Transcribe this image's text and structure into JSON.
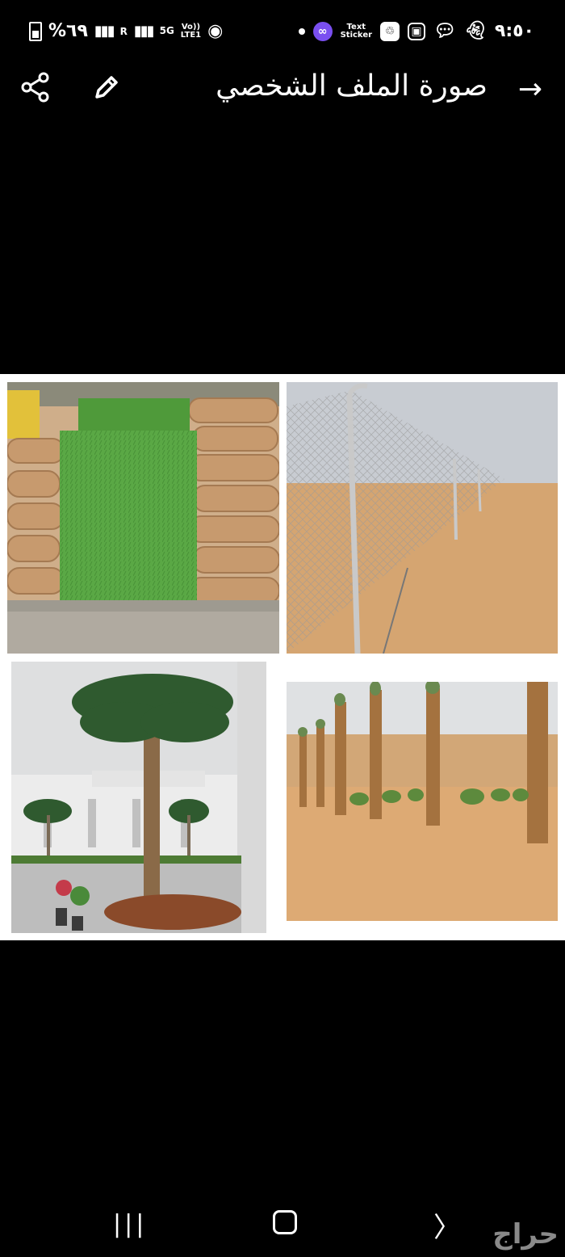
{
  "status_bar": {
    "battery": "%٦٩",
    "network_5g": "5G",
    "volte": "Vo))",
    "lte": "LTE1",
    "roaming": "R",
    "sticker_text_1": "Text",
    "sticker_text_2": "Sticker",
    "time": "٩:٥٠"
  },
  "app_bar": {
    "title": "صورة الملف الشخصي",
    "back_icon": "arrow-right-icon",
    "share_icon": "share-icon",
    "edit_icon": "pencil-icon"
  },
  "collage": {
    "images": [
      {
        "name": "grass-sod-rolls-photo"
      },
      {
        "name": "chain-link-fence-photo"
      },
      {
        "name": "palm-tree-villa-photo"
      },
      {
        "name": "palm-trunks-desert-photo"
      }
    ]
  },
  "nav_bar": {
    "recent_glyph": "|||",
    "back_glyph": "〉"
  },
  "watermark": "حراج",
  "colors": {
    "background": "#000000",
    "collage_border": "#ffffff",
    "watermark": "#8a8a8a"
  }
}
